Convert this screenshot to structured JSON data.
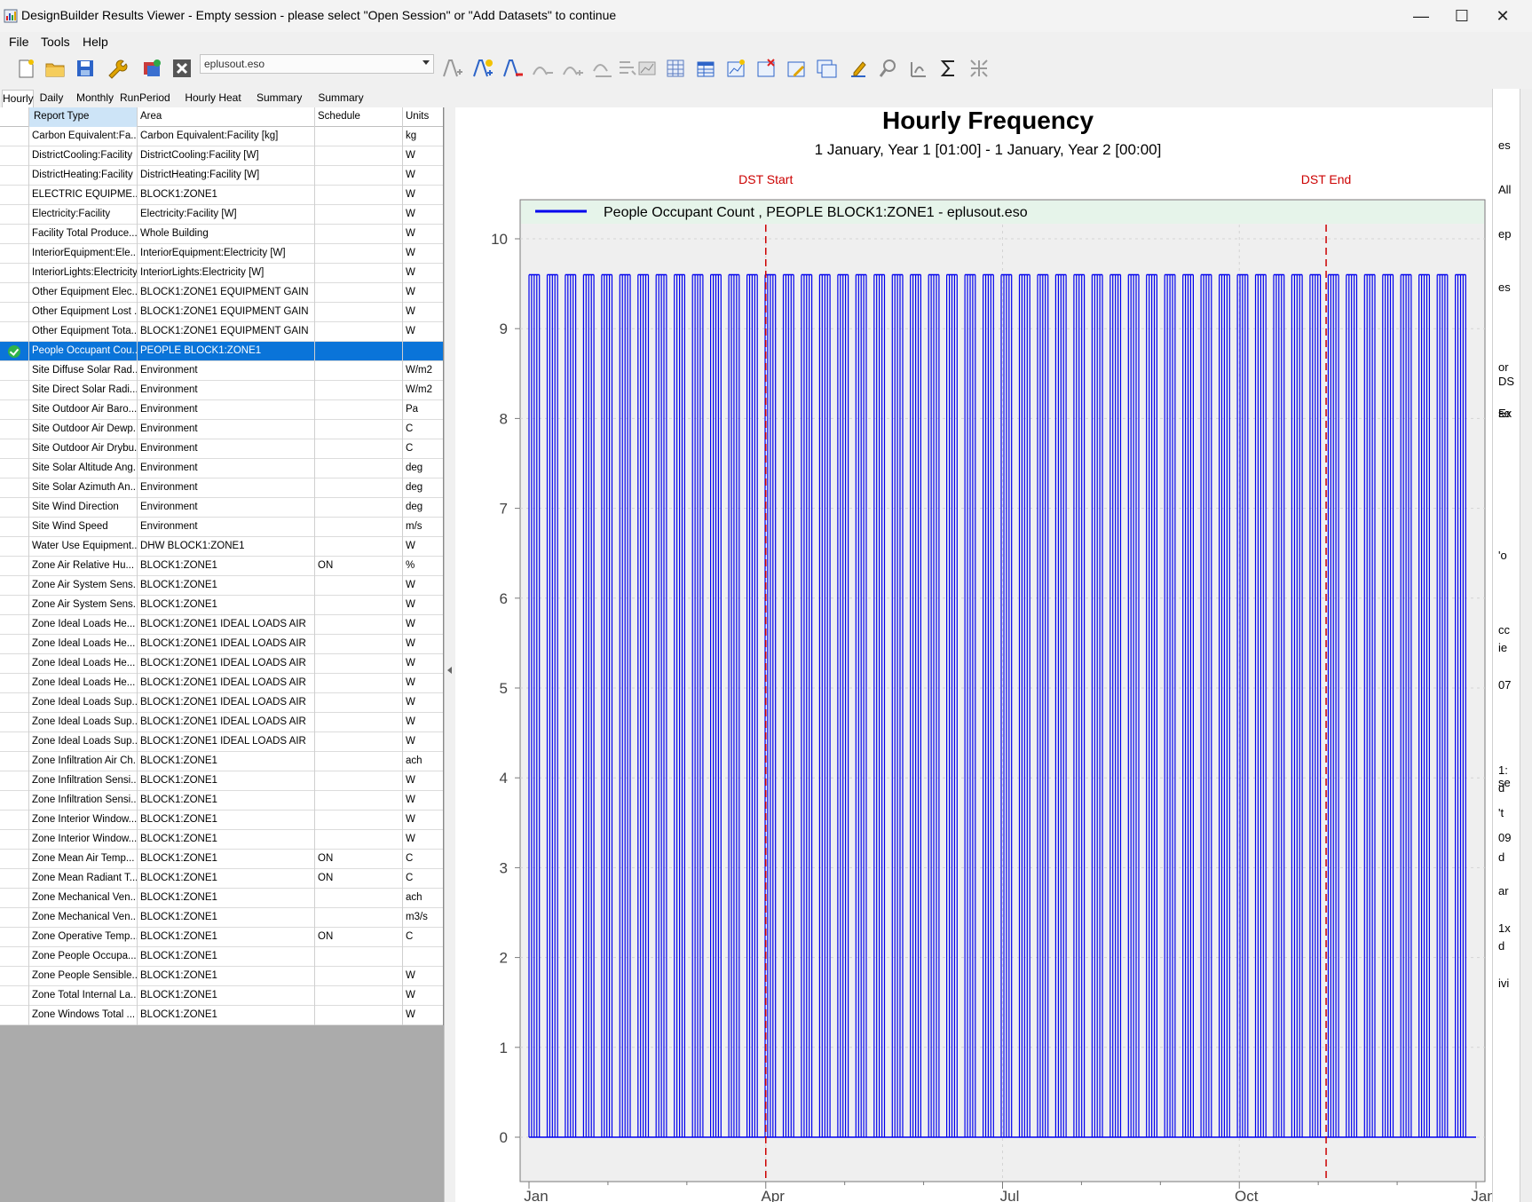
{
  "window": {
    "title": "DesignBuilder Results Viewer - Empty session - please select \"Open Session\" or \"Add Datasets\" to continue",
    "minimize_glyph": "—",
    "maximize_glyph": "☐",
    "close_glyph": "✕"
  },
  "menu": [
    "File",
    "Tools",
    "Help"
  ],
  "toolbar": {
    "dataset_value": "eplusout.eso",
    "icons": [
      "new-session-icon",
      "open-session-icon",
      "save-icon",
      "settings-wrench-icon",
      "add-datasets-icon",
      "remove-dataset-icon",
      "add-series-icon",
      "add-new-series-icon",
      "remove-series-icon",
      "series-up-icon",
      "series-down-icon",
      "series-edit-icon",
      "series-stack-icon",
      "chart-icon",
      "table-icon",
      "table-export-icon",
      "new-chart-icon",
      "delete-chart-icon",
      "edit-chart-icon",
      "copy-chart-icon",
      "annotate-icon",
      "zoom-icon",
      "pan-icon",
      "sum-icon",
      "resize-icon"
    ]
  },
  "tabs": [
    "Hourly",
    "Daily",
    "Monthly",
    "RunPeriod",
    "Hourly Heat Map",
    "Summary",
    "Summary Charts"
  ],
  "active_tab": "Hourly",
  "grid": {
    "headers": [
      "Report Type",
      "Area",
      "Schedule",
      "Units"
    ],
    "selected_row": 11,
    "rows": [
      [
        "Carbon Equivalent:Fa...",
        "Carbon Equivalent:Facility [kg]",
        "",
        "kg"
      ],
      [
        "DistrictCooling:Facility",
        "DistrictCooling:Facility [W]",
        "",
        "W"
      ],
      [
        "DistrictHeating:Facility",
        "DistrictHeating:Facility [W]",
        "",
        "W"
      ],
      [
        "ELECTRIC EQUIPME...",
        "BLOCK1:ZONE1",
        "",
        "W"
      ],
      [
        "Electricity:Facility",
        "Electricity:Facility [W]",
        "",
        "W"
      ],
      [
        "Facility Total Produce...",
        "Whole Building",
        "",
        "W"
      ],
      [
        "InteriorEquipment:Ele...",
        "InteriorEquipment:Electricity [W]",
        "",
        "W"
      ],
      [
        "InteriorLights:Electricity",
        "InteriorLights:Electricity [W]",
        "",
        "W"
      ],
      [
        "Other Equipment Elec...",
        "BLOCK1:ZONE1 EQUIPMENT GAIN",
        "",
        "W"
      ],
      [
        "Other Equipment Lost ...",
        "BLOCK1:ZONE1 EQUIPMENT GAIN",
        "",
        "W"
      ],
      [
        "Other Equipment Tota...",
        "BLOCK1:ZONE1 EQUIPMENT GAIN",
        "",
        "W"
      ],
      [
        "People Occupant Cou...",
        "PEOPLE BLOCK1:ZONE1",
        "",
        ""
      ],
      [
        "Site Diffuse Solar Rad...",
        "Environment",
        "",
        "W/m2"
      ],
      [
        "Site Direct Solar Radi...",
        "Environment",
        "",
        "W/m2"
      ],
      [
        "Site Outdoor Air Baro...",
        "Environment",
        "",
        "Pa"
      ],
      [
        "Site Outdoor Air Dewp...",
        "Environment",
        "",
        "C"
      ],
      [
        "Site Outdoor Air Drybu...",
        "Environment",
        "",
        "C"
      ],
      [
        "Site Solar Altitude Ang...",
        "Environment",
        "",
        "deg"
      ],
      [
        "Site Solar Azimuth An...",
        "Environment",
        "",
        "deg"
      ],
      [
        "Site Wind Direction",
        "Environment",
        "",
        "deg"
      ],
      [
        "Site Wind Speed",
        "Environment",
        "",
        "m/s"
      ],
      [
        "Water Use Equipment...",
        "DHW BLOCK1:ZONE1",
        "",
        "W"
      ],
      [
        "Zone Air Relative Hu...",
        "BLOCK1:ZONE1",
        "ON",
        "%"
      ],
      [
        "Zone Air System Sens...",
        "BLOCK1:ZONE1",
        "",
        "W"
      ],
      [
        "Zone Air System Sens...",
        "BLOCK1:ZONE1",
        "",
        "W"
      ],
      [
        "Zone Ideal Loads He...",
        "BLOCK1:ZONE1 IDEAL LOADS AIR",
        "",
        "W"
      ],
      [
        "Zone Ideal Loads He...",
        "BLOCK1:ZONE1 IDEAL LOADS AIR",
        "",
        "W"
      ],
      [
        "Zone Ideal Loads He...",
        "BLOCK1:ZONE1 IDEAL LOADS AIR",
        "",
        "W"
      ],
      [
        "Zone Ideal Loads He...",
        "BLOCK1:ZONE1 IDEAL LOADS AIR",
        "",
        "W"
      ],
      [
        "Zone Ideal Loads Sup...",
        "BLOCK1:ZONE1 IDEAL LOADS AIR",
        "",
        "W"
      ],
      [
        "Zone Ideal Loads Sup...",
        "BLOCK1:ZONE1 IDEAL LOADS AIR",
        "",
        "W"
      ],
      [
        "Zone Ideal Loads Sup...",
        "BLOCK1:ZONE1 IDEAL LOADS AIR",
        "",
        "W"
      ],
      [
        "Zone Infiltration Air Ch...",
        "BLOCK1:ZONE1",
        "",
        "ach"
      ],
      [
        "Zone Infiltration Sensi...",
        "BLOCK1:ZONE1",
        "",
        "W"
      ],
      [
        "Zone Infiltration Sensi...",
        "BLOCK1:ZONE1",
        "",
        "W"
      ],
      [
        "Zone Interior Window...",
        "BLOCK1:ZONE1",
        "",
        "W"
      ],
      [
        "Zone Interior Window...",
        "BLOCK1:ZONE1",
        "",
        "W"
      ],
      [
        "Zone Mean Air Temp...",
        "BLOCK1:ZONE1",
        "ON",
        "C"
      ],
      [
        "Zone Mean Radiant T...",
        "BLOCK1:ZONE1",
        "ON",
        "C"
      ],
      [
        "Zone Mechanical Ven...",
        "BLOCK1:ZONE1",
        "",
        "ach"
      ],
      [
        "Zone Mechanical Ven...",
        "BLOCK1:ZONE1",
        "",
        "m3/s"
      ],
      [
        "Zone Operative Temp...",
        "BLOCK1:ZONE1",
        "ON",
        "C"
      ],
      [
        "Zone People Occupa...",
        "BLOCK1:ZONE1",
        "",
        ""
      ],
      [
        "Zone People Sensible...",
        "BLOCK1:ZONE1",
        "",
        "W"
      ],
      [
        "Zone Total Internal La...",
        "BLOCK1:ZONE1",
        "",
        "W"
      ],
      [
        "Zone Windows Total ...",
        "BLOCK1:ZONE1",
        "",
        "W"
      ]
    ]
  },
  "chart_data": {
    "type": "bar",
    "title": "Hourly Frequency",
    "subtitle": "1 January, Year 1 [01:00] - 1 January, Year 2 [00:00]",
    "series": [
      {
        "name": "People Occupant Count , PEOPLE BLOCK1:ZONE1 - eplusout.eso",
        "color": "#0000ee",
        "pattern": "weekday occupancy blocks: 5 days at 9.6, 2 days at 0, repeating through the year",
        "peak_value": 9.6,
        "base_value": 0,
        "occupied_weekdays_per_week": 5,
        "weeks": 52
      }
    ],
    "x_tick_labels": [
      "Jan",
      "Apr",
      "Jul",
      "Oct",
      "Jan"
    ],
    "y_ticks": [
      0,
      1,
      2,
      3,
      4,
      5,
      6,
      7,
      8,
      9,
      10
    ],
    "ylim": [
      -0.4,
      10.45
    ],
    "markers": [
      {
        "label": "DST Start",
        "month_fraction": 3.0,
        "color": "#cc0000"
      },
      {
        "label": "DST End",
        "month_fraction": 10.1,
        "color": "#cc0000"
      }
    ],
    "legend_placement": "top",
    "grid": true
  },
  "right_strip_fragments": [
    "es",
    "All",
    "ep",
    "es",
    "or",
    "DS",
    "se",
    "Ex",
    "'o",
    "cc",
    "ie",
    "07",
    "1:",
    "se",
    "d",
    "'t",
    "09",
    "d",
    "ar",
    "1x",
    "d",
    "ivi"
  ]
}
